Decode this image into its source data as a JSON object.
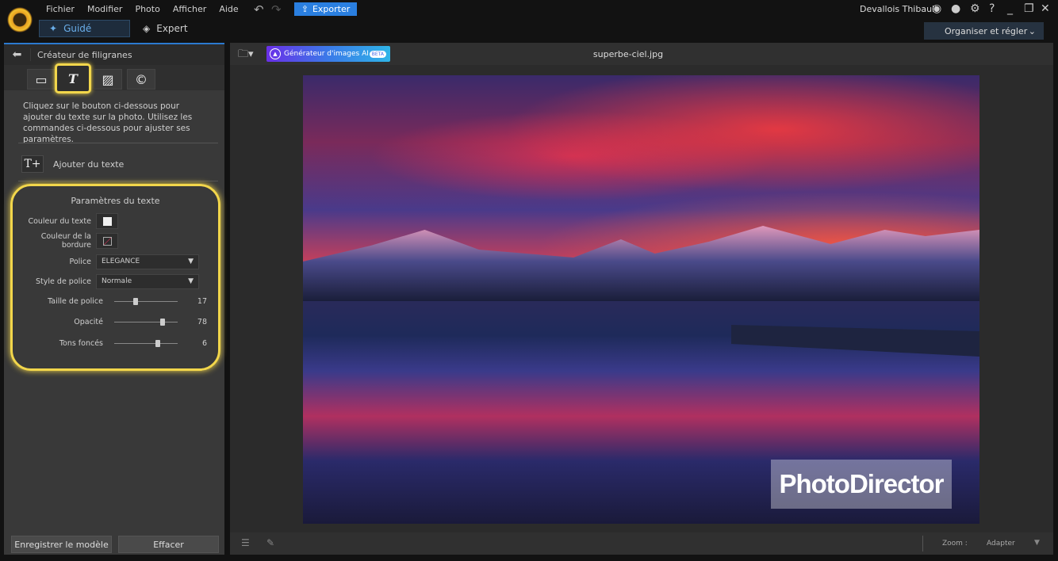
{
  "menu": [
    "Fichier",
    "Modifier",
    "Photo",
    "Afficher",
    "Aide"
  ],
  "toolbar": {
    "export": "Exporter",
    "undo_icon": "undo-icon",
    "redo_icon": "redo-icon"
  },
  "modes": {
    "guided": "Guidé",
    "expert": "Expert"
  },
  "user": {
    "name": "Devallois Thibault"
  },
  "workspace": {
    "label": "Organiser et régler"
  },
  "panel": {
    "title": "Créateur de filigranes",
    "tabs": [
      "rectangle-icon",
      "text-icon",
      "image-icon",
      "copyright-icon"
    ],
    "selected_tab": 1,
    "description": "Cliquez sur le bouton ci-dessous pour ajouter du texte sur la photo. Utilisez les commandes ci-dessous pour ajuster ses paramètres.",
    "add_text": "Ajouter du texte",
    "add_text_icon": "T+",
    "params_title": "Paramètres du texte",
    "text_color_label": "Couleur du texte",
    "text_color": "#f0f0f0",
    "border_color_label": "Couleur de la bordure",
    "font_label": "Police",
    "font_value": "ELEGANCE",
    "style_label": "Style de police",
    "style_value": "Normale",
    "size_label": "Taille de police",
    "size_value": "17",
    "opacity_label": "Opacité",
    "opacity_value": "78",
    "shadow_label": "Tons foncés",
    "shadow_value": "6",
    "save": "Enregistrer le modèle",
    "clear": "Effacer"
  },
  "main": {
    "ai_generator": "Générateur d'images AI",
    "beta": "BETA",
    "filename": "superbe-ciel.jpg",
    "watermark": "PhotoDirector",
    "zoom_label": "Zoom :",
    "zoom_value": "Adapter"
  },
  "colors": {
    "accent": "#2a7fe0",
    "highlight": "#f2d64b"
  }
}
